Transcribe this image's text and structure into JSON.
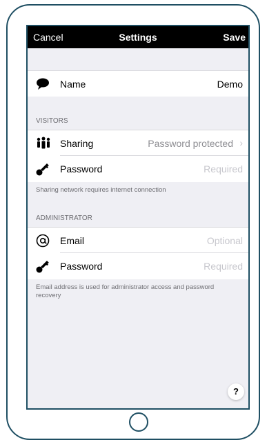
{
  "navbar": {
    "cancel": "Cancel",
    "title": "Settings",
    "save": "Save"
  },
  "profile": {
    "name_label": "Name",
    "name_value": "Demo",
    "icon": "speech-bubble-icon"
  },
  "visitors": {
    "header": "VISITORS",
    "sharing_label": "Sharing",
    "sharing_value": "Password protected",
    "sharing_icon": "people-icon",
    "password_label": "Password",
    "password_placeholder": "Required",
    "password_icon": "key-icon",
    "note": "Sharing network requires internet connection"
  },
  "administrator": {
    "header": "ADMINISTRATOR",
    "email_label": "Email",
    "email_placeholder": "Optional",
    "email_icon": "at-sign-icon",
    "password_label": "Password",
    "password_placeholder": "Required",
    "password_icon": "key-icon",
    "note": "Email address is used for administrator access and password recovery"
  },
  "help": {
    "label": "?"
  },
  "colors": {
    "device_border": "#1f4f63",
    "navbar_bg": "#000000",
    "grouped_bg": "#efeff4",
    "placeholder": "#c7c7cd"
  }
}
